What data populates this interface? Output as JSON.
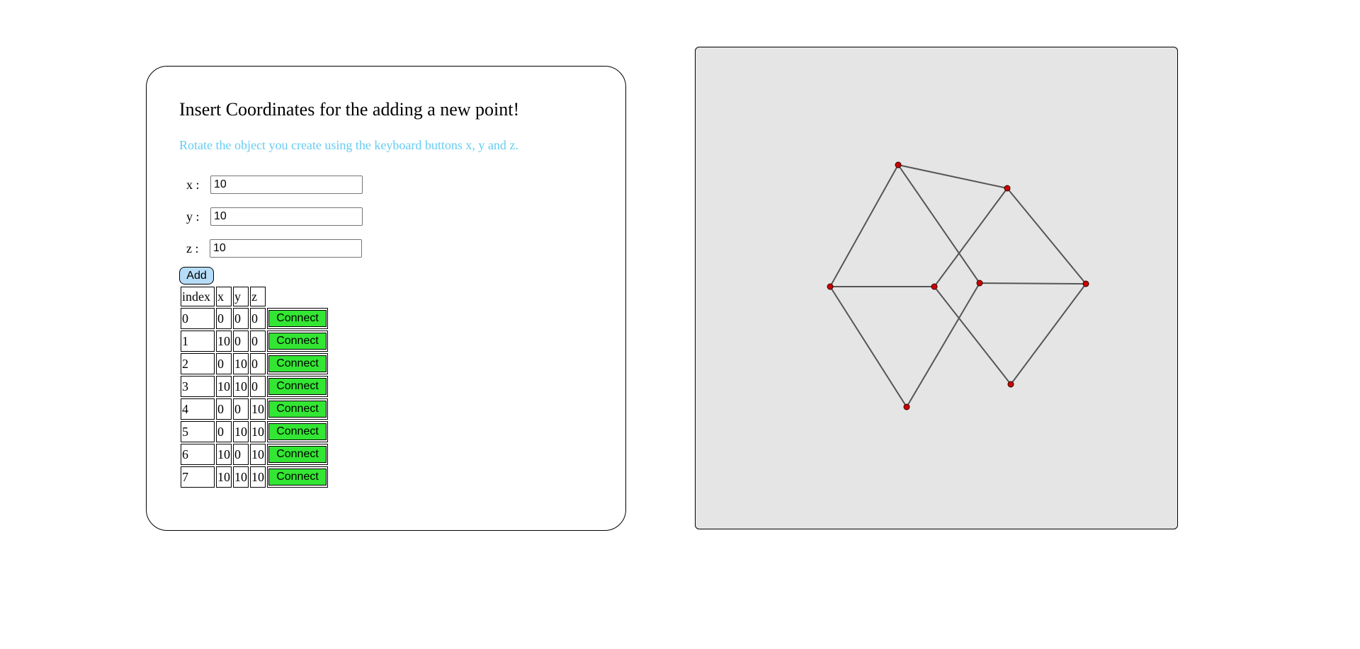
{
  "form": {
    "title": "Insert Coordinates for the adding a new point!",
    "hint": "Rotate the object you create using the keyboard buttons x, y and z.",
    "fields": [
      {
        "label": "x :",
        "value": "10"
      },
      {
        "label": "y :",
        "value": "10"
      },
      {
        "label": "z :",
        "value": "10"
      }
    ],
    "add_label": "Add"
  },
  "table": {
    "headers": [
      "index",
      "x",
      "y",
      "z"
    ],
    "connect_label": "Connect",
    "connect_color": "#33e633",
    "rows": [
      [
        "0",
        "0",
        "0",
        "0"
      ],
      [
        "1",
        "10",
        "0",
        "0"
      ],
      [
        "2",
        "0",
        "10",
        "0"
      ],
      [
        "3",
        "10",
        "10",
        "0"
      ],
      [
        "4",
        "0",
        "0",
        "10"
      ],
      [
        "5",
        "0",
        "10",
        "10"
      ],
      [
        "6",
        "10",
        "0",
        "10"
      ],
      [
        "7",
        "10",
        "10",
        "10"
      ]
    ]
  },
  "colors": {
    "hint": "#66ccf2",
    "add_button": "#b6dcf7",
    "canvas_background": "#e5e5e5",
    "vertex": "#cc0000",
    "edge": "#555555"
  }
}
